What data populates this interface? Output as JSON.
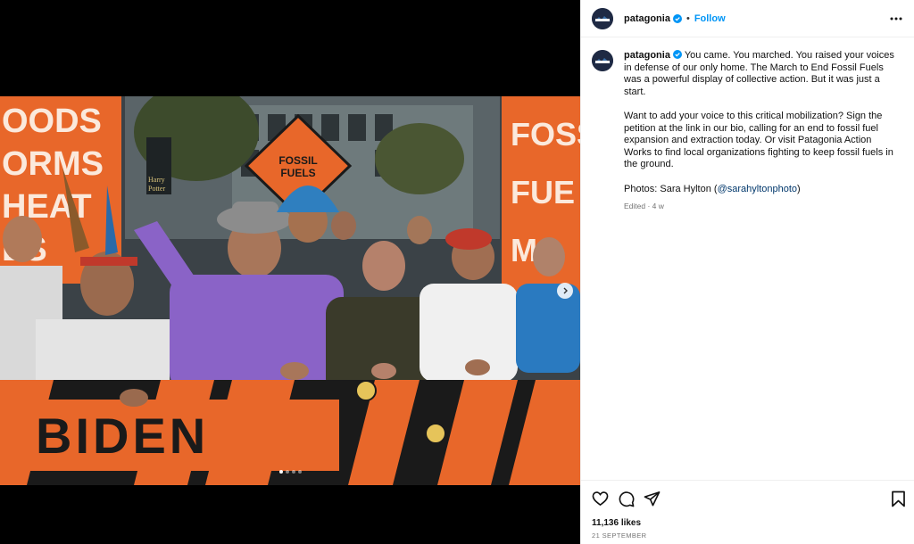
{
  "post": {
    "username": "patagonia",
    "separator": "•",
    "follow_label": "Follow",
    "caption_paragraphs": [
      "You came. You marched. You raised your voices in defense of our only home. The March to End Fossil Fuels was a powerful display of collective action. But it was just a start.",
      "Want to add your voice to this critical mobilization? Sign the petition at the link in our bio, calling for an end to fossil fuel expansion and extraction today. Or visit Patagonia Action Works to find local organizations fighting to keep fossil fuels in the ground."
    ],
    "credit_prefix": "Photos: Sara Hylton (",
    "credit_mention": "@sarahyltonphoto",
    "credit_suffix": ")",
    "edited_meta": "Edited · 4 w",
    "likes": "11,136 likes",
    "date": "21 SEPTEMBER"
  },
  "media": {
    "carousel_total": 4,
    "carousel_active": 1,
    "signs": {
      "left_sign": [
        "OODS",
        "ORMS",
        "HEAT",
        "ES"
      ],
      "diamond_sign": [
        "FOSSIL",
        "FUELS"
      ],
      "right_sign": [
        "FOSS",
        "FUE",
        "M"
      ],
      "banner": "BIDEN",
      "harry_potter": [
        "Harry",
        "Potter"
      ]
    }
  },
  "icons": {
    "verified": "verified-badge-icon",
    "more": "more-options-icon",
    "next": "chevron-right-icon",
    "like": "heart-icon",
    "comment": "comment-icon",
    "share": "share-icon",
    "save": "bookmark-icon"
  },
  "colors": {
    "accent": "#0095f6",
    "orange": "#e8672a",
    "panel_bg": "#ffffff",
    "meta_text": "#737373"
  }
}
